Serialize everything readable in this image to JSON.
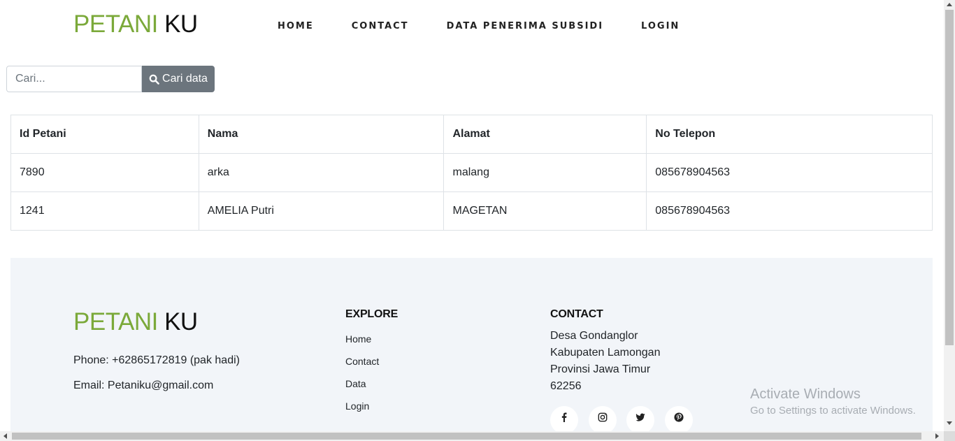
{
  "header": {
    "brand_part1": "PETANI",
    "brand_part2": "KU",
    "nav": [
      "HOME",
      "CONTACT",
      "DATA PENERIMA SUBSIDI",
      "LOGIN"
    ]
  },
  "search": {
    "placeholder": "Cari...",
    "button_label": "Cari data",
    "button_icon": "search-icon"
  },
  "table": {
    "columns": [
      "Id Petani",
      "Nama",
      "Alamat",
      "No Telepon"
    ],
    "rows": [
      [
        "7890",
        "arka",
        "malang",
        "085678904563"
      ],
      [
        "1241",
        "AMELIA Putri",
        "MAGETAN",
        "085678904563"
      ]
    ]
  },
  "footer": {
    "brand_part1": "PETANI",
    "brand_part2": "KU",
    "phone": "Phone: +62865172819 (pak hadi)",
    "email": "Email: Petaniku@gmail.com",
    "explore_heading": "EXPLORE",
    "explore_links": [
      "Home",
      "Contact",
      "Data",
      "Login"
    ],
    "contact_heading": "CONTACT",
    "address": [
      "Desa Gondanglor",
      "Kabupaten Lamongan",
      "Provinsi Jawa Timur",
      "62256"
    ],
    "social_icons": [
      "facebook-icon",
      "instagram-icon",
      "twitter-icon",
      "pinterest-icon"
    ]
  },
  "watermark": {
    "title": "Activate Windows",
    "subtitle": "Go to Settings to activate Windows."
  },
  "colors": {
    "brand_green": "#7ba93a",
    "button_gray": "#6c757d",
    "footer_bg": "#f2f5f9"
  }
}
